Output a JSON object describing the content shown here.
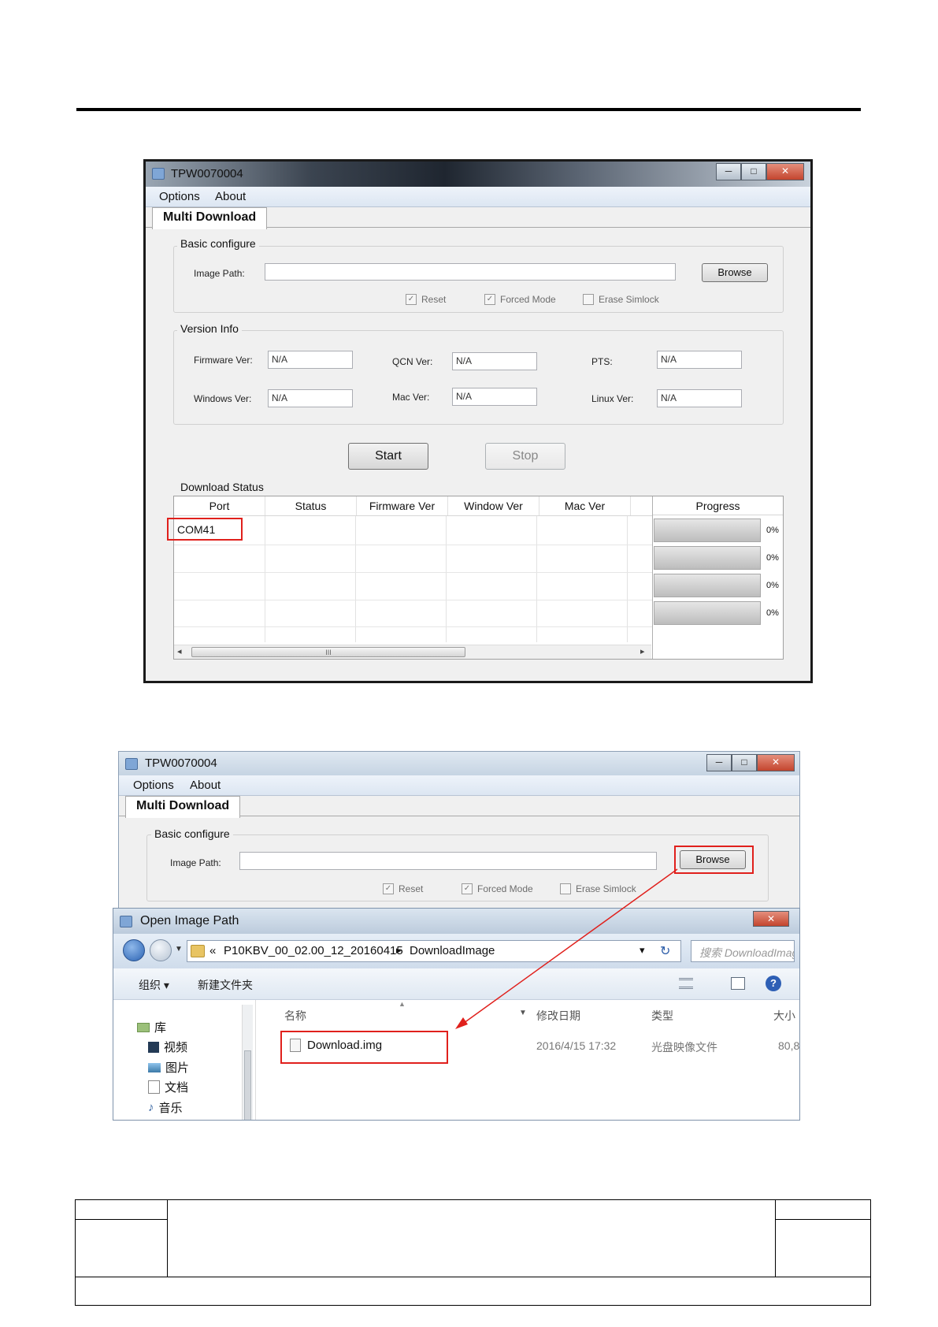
{
  "window1": {
    "title": "TPW0070004",
    "menu": [
      "Options",
      "About"
    ],
    "tab": "Multi Download",
    "controls": [
      "─",
      "□",
      "✕"
    ],
    "basic_configure": {
      "group_label": "Basic configure",
      "image_path_label": "Image Path:",
      "image_path_value": "",
      "browse_label": "Browse",
      "checkboxes": [
        {
          "label": "Reset",
          "checked": true
        },
        {
          "label": "Forced Mode",
          "checked": true
        },
        {
          "label": "Erase Simlock",
          "checked": false
        }
      ]
    },
    "version_info": {
      "group_label": "Version Info",
      "fields": [
        {
          "label": "Firmware Ver:",
          "value": "N/A"
        },
        {
          "label": "QCN Ver:",
          "value": "N/A"
        },
        {
          "label": "PTS:",
          "value": "N/A"
        },
        {
          "label": "Windows Ver:",
          "value": "N/A"
        },
        {
          "label": "Mac Ver:",
          "value": "N/A"
        },
        {
          "label": "Linux Ver:",
          "value": "N/A"
        }
      ]
    },
    "start_label": "Start",
    "stop_label": "Stop",
    "download_status": {
      "group_label": "Download Status",
      "columns": [
        "Port",
        "Status",
        "Firmware Ver",
        "Window Ver",
        "Mac Ver"
      ],
      "progress_header": "Progress",
      "port_value": "COM41",
      "progress": [
        {
          "value": 0,
          "label": "0%"
        },
        {
          "value": 0,
          "label": "0%"
        },
        {
          "value": 0,
          "label": "0%"
        },
        {
          "value": 0,
          "label": "0%"
        }
      ],
      "scroll_thumb": "III",
      "scroll_left": "◂",
      "scroll_right": "▸"
    }
  },
  "window2": {
    "title": "TPW0070004",
    "menu": [
      "Options",
      "About"
    ],
    "tab": "Multi Download",
    "controls": [
      "─",
      "□",
      "✕"
    ],
    "group_label": "Basic configure",
    "image_path_label": "Image Path:",
    "browse_label": "Browse",
    "checkboxes": [
      {
        "label": "Reset",
        "checked": true
      },
      {
        "label": "Forced Mode",
        "checked": true
      },
      {
        "label": "Erase Simlock",
        "checked": false
      }
    ]
  },
  "dialog": {
    "title": "Open Image Path",
    "close_label": "✕",
    "address": {
      "prefix": "«",
      "folder1": "P10KBV_00_02.00_12_20160415",
      "sep": "▸",
      "folder2": "DownloadImage",
      "dropdown": "▾",
      "refresh": "↻"
    },
    "search_placeholder": "搜索 DownloadImage",
    "toolbar": {
      "organize": "组织 ▾",
      "new_folder": "新建文件夹",
      "help": "?"
    },
    "tree": [
      "库",
      "视频",
      "图片",
      "文档",
      "音乐"
    ],
    "columns": {
      "name": "名称",
      "modified": "修改日期",
      "type": "类型",
      "size": "大小"
    },
    "file": {
      "name": "Download.img",
      "modified": "2016/4/15 17:32",
      "type": "光盘映像文件",
      "size": "80,8"
    }
  },
  "colors": {
    "highlight": "#e0201c"
  }
}
